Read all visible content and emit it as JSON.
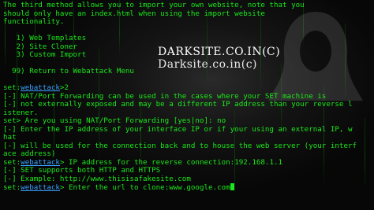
{
  "watermark": {
    "line1": "DARKSITE.CO.IN(C)",
    "line2": "Darksite.co.in(c)"
  },
  "terminal": {
    "lines": [
      {
        "text": "The third method allows you to import your own website, note that you"
      },
      {
        "text": "should only have an index.html when using the import website"
      },
      {
        "text": "functionality."
      },
      {
        "text": ""
      },
      {
        "text": "   1) Web Templates"
      },
      {
        "text": "   2) Site Cloner"
      },
      {
        "text": "   3) Custom Import"
      },
      {
        "text": ""
      },
      {
        "text": "  99) Return to Webattack Menu"
      },
      {
        "text": ""
      },
      {
        "prompt": "set",
        "ctx": "webattack",
        "rest": ">2"
      },
      {
        "text": "[-] NAT/Port Forwarding can be used in the cases where your SET machine is"
      },
      {
        "text": "[-] not externally exposed and may be a different IP address than your reverse l"
      },
      {
        "text": "istener."
      },
      {
        "text": "set> Are you using NAT/Port Forwarding [yes|no]: no"
      },
      {
        "text": "[-] Enter the IP address of your interface IP or if your using an external IP, w"
      },
      {
        "text": "hat"
      },
      {
        "text": "[-] will be used for the connection back and to house the web server (your interf"
      },
      {
        "text": "ace address)"
      },
      {
        "prompt": "set",
        "ctx": "webattack",
        "rest": "> IP address for the reverse connection:192.168.1.1"
      },
      {
        "text": "[-] SET supports both HTTP and HTTPS"
      },
      {
        "text": "[-] Example: http://www.thisisafakesite.com"
      },
      {
        "prompt": "set",
        "ctx": "webattack",
        "rest": "> Enter the url to clone:www.google.com",
        "cursor": true
      }
    ]
  },
  "colors": {
    "text": "#1be81b",
    "prompt_context": "#3aa0ff",
    "background": "#050505"
  }
}
